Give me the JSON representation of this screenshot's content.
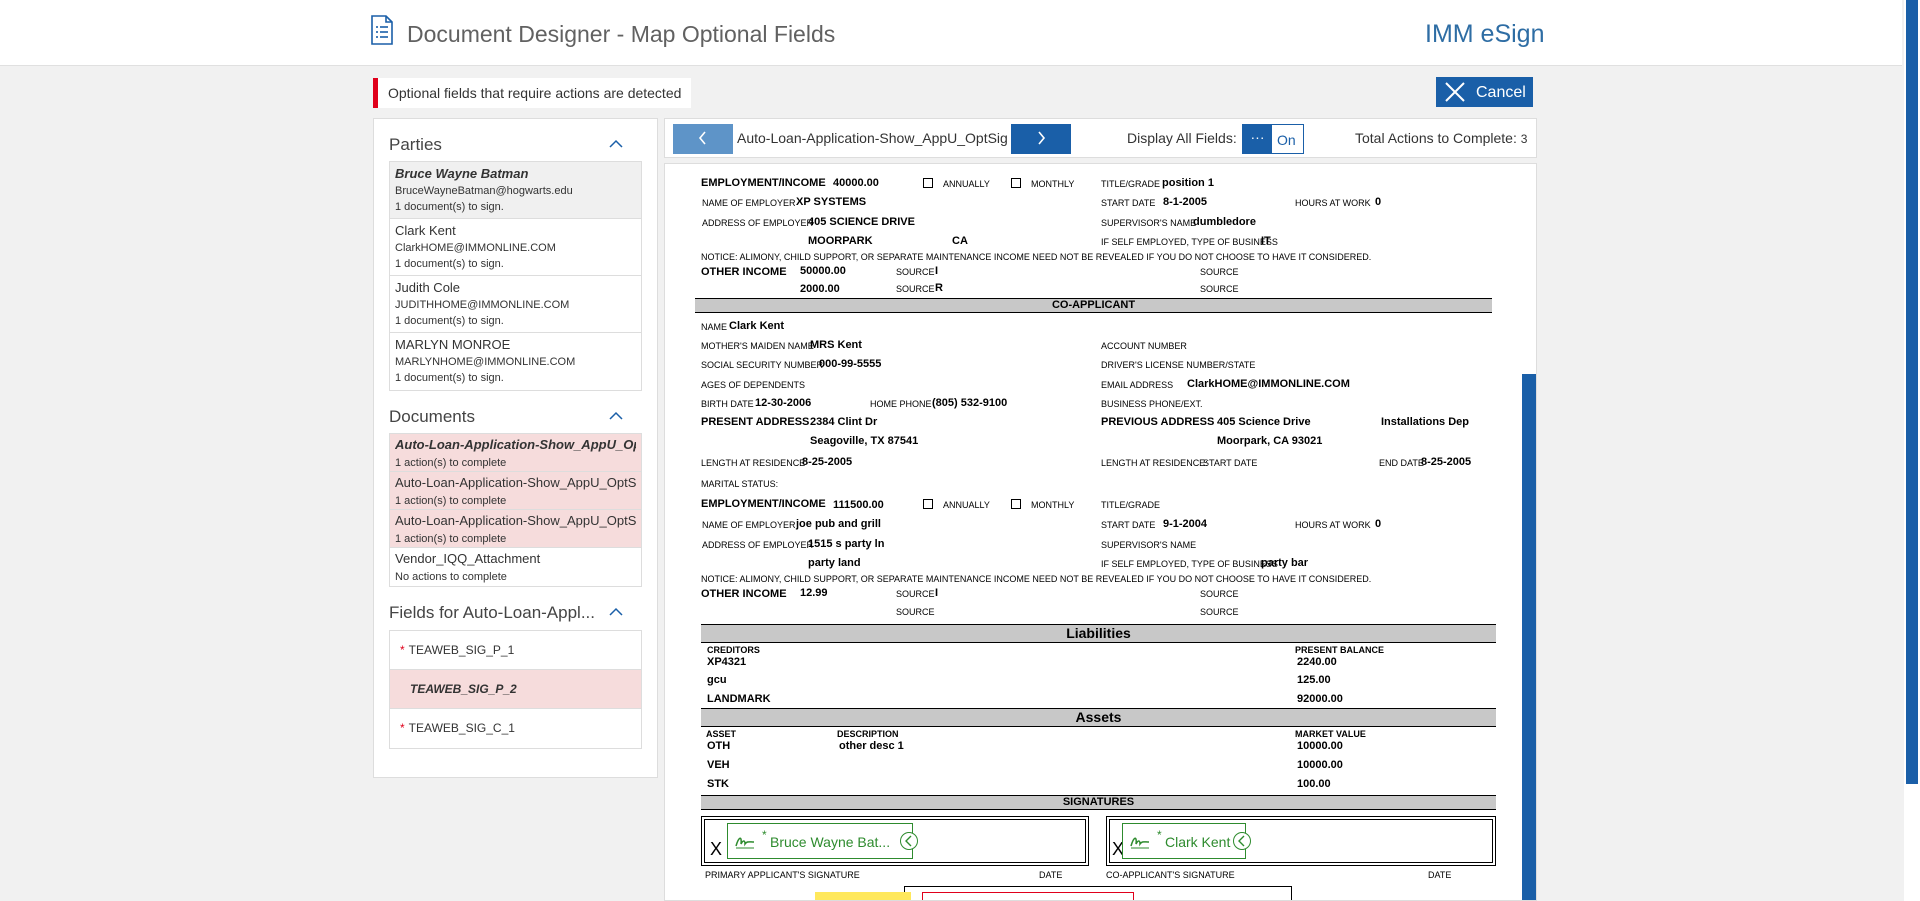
{
  "header": {
    "title": "Document Designer - Map Optional Fields",
    "brand": "IMM eSign"
  },
  "alert": {
    "text": "Optional fields that require actions are detected"
  },
  "cancel": {
    "label": "Cancel"
  },
  "parties": {
    "title": "Parties",
    "items": [
      {
        "name": "Bruce Wayne Batman",
        "email": "BruceWayneBatman@hogwarts.edu",
        "count": "1 document(s) to sign."
      },
      {
        "name": "Clark Kent",
        "email": "ClarkHOME@IMMONLINE.COM",
        "count": "1 document(s) to sign."
      },
      {
        "name": "Judith Cole",
        "email": "JUDITHHOME@IMMONLINE.COM",
        "count": "1 document(s) to sign."
      },
      {
        "name": "MARLYN MONROE",
        "email": "MARLYNHOME@IMMONLINE.COM",
        "count": "1 document(s) to sign."
      }
    ]
  },
  "documents": {
    "title": "Documents",
    "items": [
      {
        "name": "Auto-Loan-Application-Show_AppU_OptSig",
        "status": "1 action(s) to complete"
      },
      {
        "name": "Auto-Loan-Application-Show_AppU_OptSig",
        "status": "1 action(s) to complete"
      },
      {
        "name": "Auto-Loan-Application-Show_AppU_OptSig",
        "status": "1 action(s) to complete"
      },
      {
        "name": "Vendor_IQQ_Attachment",
        "status": "No actions to complete"
      }
    ]
  },
  "fields": {
    "title": "Fields for Auto-Loan-Appl...",
    "items": [
      {
        "name": "TEAWEB_SIG_P_1",
        "required": "*"
      },
      {
        "name": "TEAWEB_SIG_P_2",
        "required": ""
      },
      {
        "name": "TEAWEB_SIG_C_1",
        "required": "*"
      }
    ]
  },
  "toolbar": {
    "doc_name": "Auto-Loan-Application-Show_AppU_OptSig",
    "display_label": "Display All Fields:",
    "toggle_dots": "···",
    "toggle_state": "On",
    "total_label": "Total Actions to Complete:",
    "total_value": "3"
  },
  "doc": {
    "applicant": {
      "employment_label": "EMPLOYMENT/INCOME",
      "employment_value": "40000.00",
      "annually": "ANNUALLY",
      "monthly": "MONTHLY",
      "title_label": "TITLE/GRADE",
      "title_value": "position 1",
      "employer_label": "NAME OF EMPLOYER",
      "employer_value": "XP SYSTEMS",
      "start_label": "START DATE",
      "start_value": "8-1-2005",
      "hours_label": "HOURS AT WORK",
      "hours_value": "0",
      "emp_addr_label": "ADDRESS OF EMPLOYER",
      "emp_addr_value": "405 SCIENCE DRIVE",
      "supervisor_label": "SUPERVISOR'S NAME",
      "supervisor_value": "dumbledore",
      "emp_city": "MOORPARK",
      "emp_state": "CA",
      "self_emp_label": "IF SELF EMPLOYED, TYPE OF BUSINESS",
      "self_emp_value": "IT",
      "notice": "NOTICE: ALIMONY, CHILD SUPPORT, OR SEPARATE MAINTENANCE INCOME NEED NOT BE REVEALED IF YOU DO NOT CHOOSE TO HAVE IT CONSIDERED.",
      "other_income_label": "OTHER INCOME",
      "other_income_1": "50000.00",
      "other_income_2": "2000.00",
      "source_label": "SOURCE",
      "source_1": "I",
      "source_2": "R"
    },
    "coapp_header": "CO-APPLICANT",
    "coapp": {
      "name_label": "NAME",
      "name_value": "Clark Kent",
      "maiden_label": "MOTHER'S MAIDEN NAME",
      "maiden_value": "MRS Kent",
      "account_label": "ACCOUNT NUMBER",
      "ssn_label": "SOCIAL SECURITY NUMBER",
      "ssn_value": "000-99-5555",
      "dl_label": "DRIVER'S LICENSE NUMBER/STATE",
      "ages_label": "AGES OF DEPENDENTS",
      "email_label": "EMAIL ADDRESS",
      "email_value": "ClarkHOME@IMMONLINE.COM",
      "birth_label": "BIRTH DATE",
      "birth_value": "12-30-2006",
      "home_label": "HOME PHONE",
      "home_value": "(805) 532-9100",
      "bizphone_label": "BUSINESS PHONE/EXT.",
      "present_label": "PRESENT ADDRESS",
      "present_value": "2384 Clint Dr",
      "present_city": "Seagoville, TX 87541",
      "previous_label": "PREVIOUS ADDRESS",
      "previous_value": "405 Science Drive",
      "previous_city": "Moorpark, CA 93021",
      "previous_extra": "Installations Dep",
      "lar_label": "LENGTH AT RESIDENCE",
      "lar_value": "8-25-2005",
      "lar2_label": "LENGTH AT RESIDENCE:",
      "lar2_start": "START DATE",
      "end_label": "END DATE",
      "end_value": "8-25-2005",
      "marital_label": "MARITAL STATUS:",
      "employment_label": "EMPLOYMENT/INCOME",
      "employment_value": "111500.00",
      "annually": "ANNUALLY",
      "monthly": "MONTHLY",
      "title_label": "TITLE/GRADE",
      "employer_label": "NAME OF EMPLOYER",
      "employer_value": "joe pub and grill",
      "start_label": "START DATE",
      "start_value": "9-1-2004",
      "hours_label": "HOURS AT WORK",
      "hours_value": "0",
      "emp_addr_label": "ADDRESS OF EMPLOYER",
      "emp_addr_value": "1515 s party ln",
      "emp_city": "party land",
      "supervisor_label": "SUPERVISOR'S NAME",
      "self_emp_label": "IF SELF EMPLOYED, TYPE OF BUSINESS",
      "self_emp_value": "party bar",
      "notice": "NOTICE: ALIMONY, CHILD SUPPORT, OR SEPARATE MAINTENANCE INCOME NEED NOT BE REVEALED IF YOU DO NOT CHOOSE TO HAVE IT CONSIDERED.",
      "other_income_label": "OTHER INCOME",
      "other_income_1": "12.99",
      "source_label": "SOURCE",
      "source_1": "I"
    },
    "liabilities": {
      "header": "Liabilities",
      "col1": "CREDITORS",
      "col2": "PRESENT BALANCE",
      "rows": [
        {
          "name": "XP4321",
          "value": "2240.00"
        },
        {
          "name": "gcu",
          "value": "125.00"
        },
        {
          "name": "LANDMARK",
          "value": "92000.00"
        }
      ]
    },
    "assets": {
      "header": "Assets",
      "col1": "ASSET",
      "col2": "DESCRIPTION",
      "col3": "MARKET VALUE",
      "rows": [
        {
          "name": "OTH",
          "desc": "other desc 1",
          "value": "10000.00"
        },
        {
          "name": "VEH",
          "desc": "",
          "value": "10000.00"
        },
        {
          "name": "STK",
          "desc": "",
          "value": "100.00"
        }
      ]
    },
    "signatures": {
      "header": "SIGNATURES",
      "x": "X",
      "primary_label": "PRIMARY APPLICANT'S SIGNATURE",
      "co_label": "CO-APPLICANT'S SIGNATURE",
      "date_label": "DATE",
      "field1": {
        "star": "*",
        "name": "Bruce Wayne Bat..."
      },
      "field2": {
        "star": "*",
        "name": "Clark Kent"
      }
    }
  }
}
